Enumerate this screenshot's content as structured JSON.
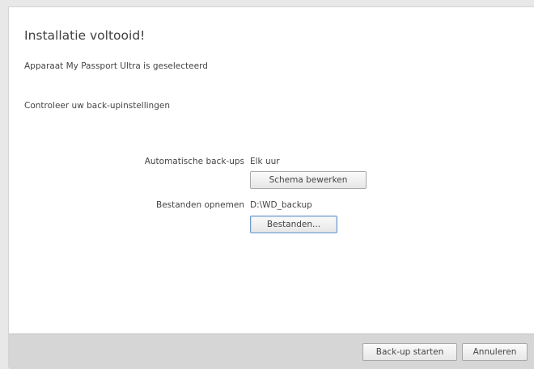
{
  "dialog": {
    "title": "Installatie voltooid!",
    "device_selected": "Apparaat My Passport Ultra is geselecteerd",
    "check_settings": "Controleer uw back-upinstellingen"
  },
  "settings": {
    "auto_backup_label": "Automatische back-ups",
    "auto_backup_value": "Elk uur",
    "edit_schedule_button": "Schema bewerken",
    "include_files_label": "Bestanden opnemen",
    "include_files_value": "D:\\WD_backup",
    "files_button": "Bestanden..."
  },
  "footer": {
    "start_backup_button": "Back-up starten",
    "cancel_button": "Annuleren"
  }
}
